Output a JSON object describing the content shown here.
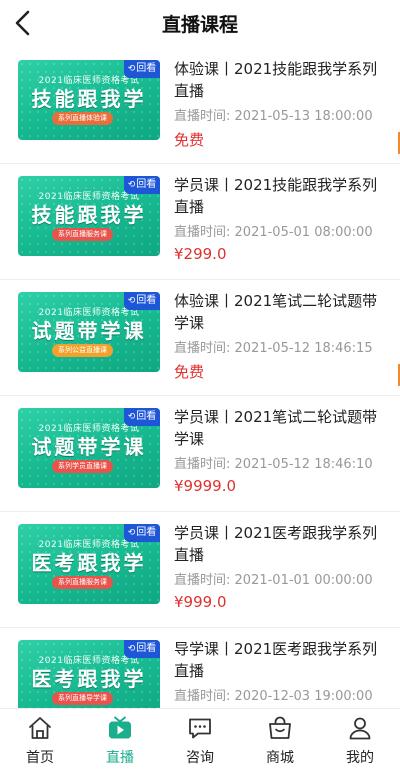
{
  "header": {
    "title": "直播课程"
  },
  "courses": [
    {
      "title": "体验课丨2021技能跟我学系列直播",
      "time_label": "直播时间:",
      "time": "2021-05-13 18:00:00",
      "price": "免费",
      "replay": "回看",
      "thumb_sub": "2021临床医师资格考试",
      "thumb_big": "技能跟我学",
      "thumb_bar": "系列直播体验课",
      "bar_color": "#e86f3c"
    },
    {
      "title": "学员课丨2021技能跟我学系列直播",
      "time_label": "直播时间:",
      "time": "2021-05-01 08:00:00",
      "price": "¥299.0",
      "replay": "回看",
      "thumb_sub": "2021临床医师资格考试",
      "thumb_big": "技能跟我学",
      "thumb_bar": "系列直播服务课",
      "bar_color": "#e8544c"
    },
    {
      "title": "体验课丨2021笔试二轮试题带学课",
      "time_label": "直播时间:",
      "time": "2021-05-12 18:46:15",
      "price": "免费",
      "replay": "回看",
      "thumb_sub": "2021临床医师资格考试",
      "thumb_big": "试题带学课",
      "thumb_bar": "系列公益直播课",
      "bar_color": "#f2a22c"
    },
    {
      "title": "学员课丨2021笔试二轮试题带学课",
      "time_label": "直播时间:",
      "time": "2021-05-12 18:46:10",
      "price": "¥9999.0",
      "replay": "回看",
      "thumb_sub": "2021临床医师资格考试",
      "thumb_big": "试题带学课",
      "thumb_bar": "系列学员直播课",
      "bar_color": "#e8544c"
    },
    {
      "title": "学员课丨2021医考跟我学系列直播",
      "time_label": "直播时间:",
      "time": "2021-01-01 00:00:00",
      "price": "¥999.0",
      "replay": "回看",
      "thumb_sub": "2021临床医师资格考试",
      "thumb_big": "医考跟我学",
      "thumb_bar": "系列直播服务课",
      "bar_color": "#e8544c"
    },
    {
      "title": "导学课丨2021医考跟我学系列直播",
      "time_label": "直播时间:",
      "time": "2020-12-03 19:00:00",
      "price": "",
      "replay": "回看",
      "thumb_sub": "2021临床医师资格考试",
      "thumb_big": "医考跟我学",
      "thumb_bar": "系列直播导学课",
      "bar_color": "#e8544c"
    }
  ],
  "tabs": [
    {
      "label": "首页",
      "icon": "home-icon"
    },
    {
      "label": "直播",
      "icon": "live-icon",
      "active": true
    },
    {
      "label": "咨询",
      "icon": "chat-icon"
    },
    {
      "label": "商城",
      "icon": "shop-icon"
    },
    {
      "label": "我的",
      "icon": "user-icon"
    }
  ],
  "colors": {
    "accent": "#1aae8e",
    "price": "#e0312d",
    "replay_badge": "#1e56d8"
  }
}
